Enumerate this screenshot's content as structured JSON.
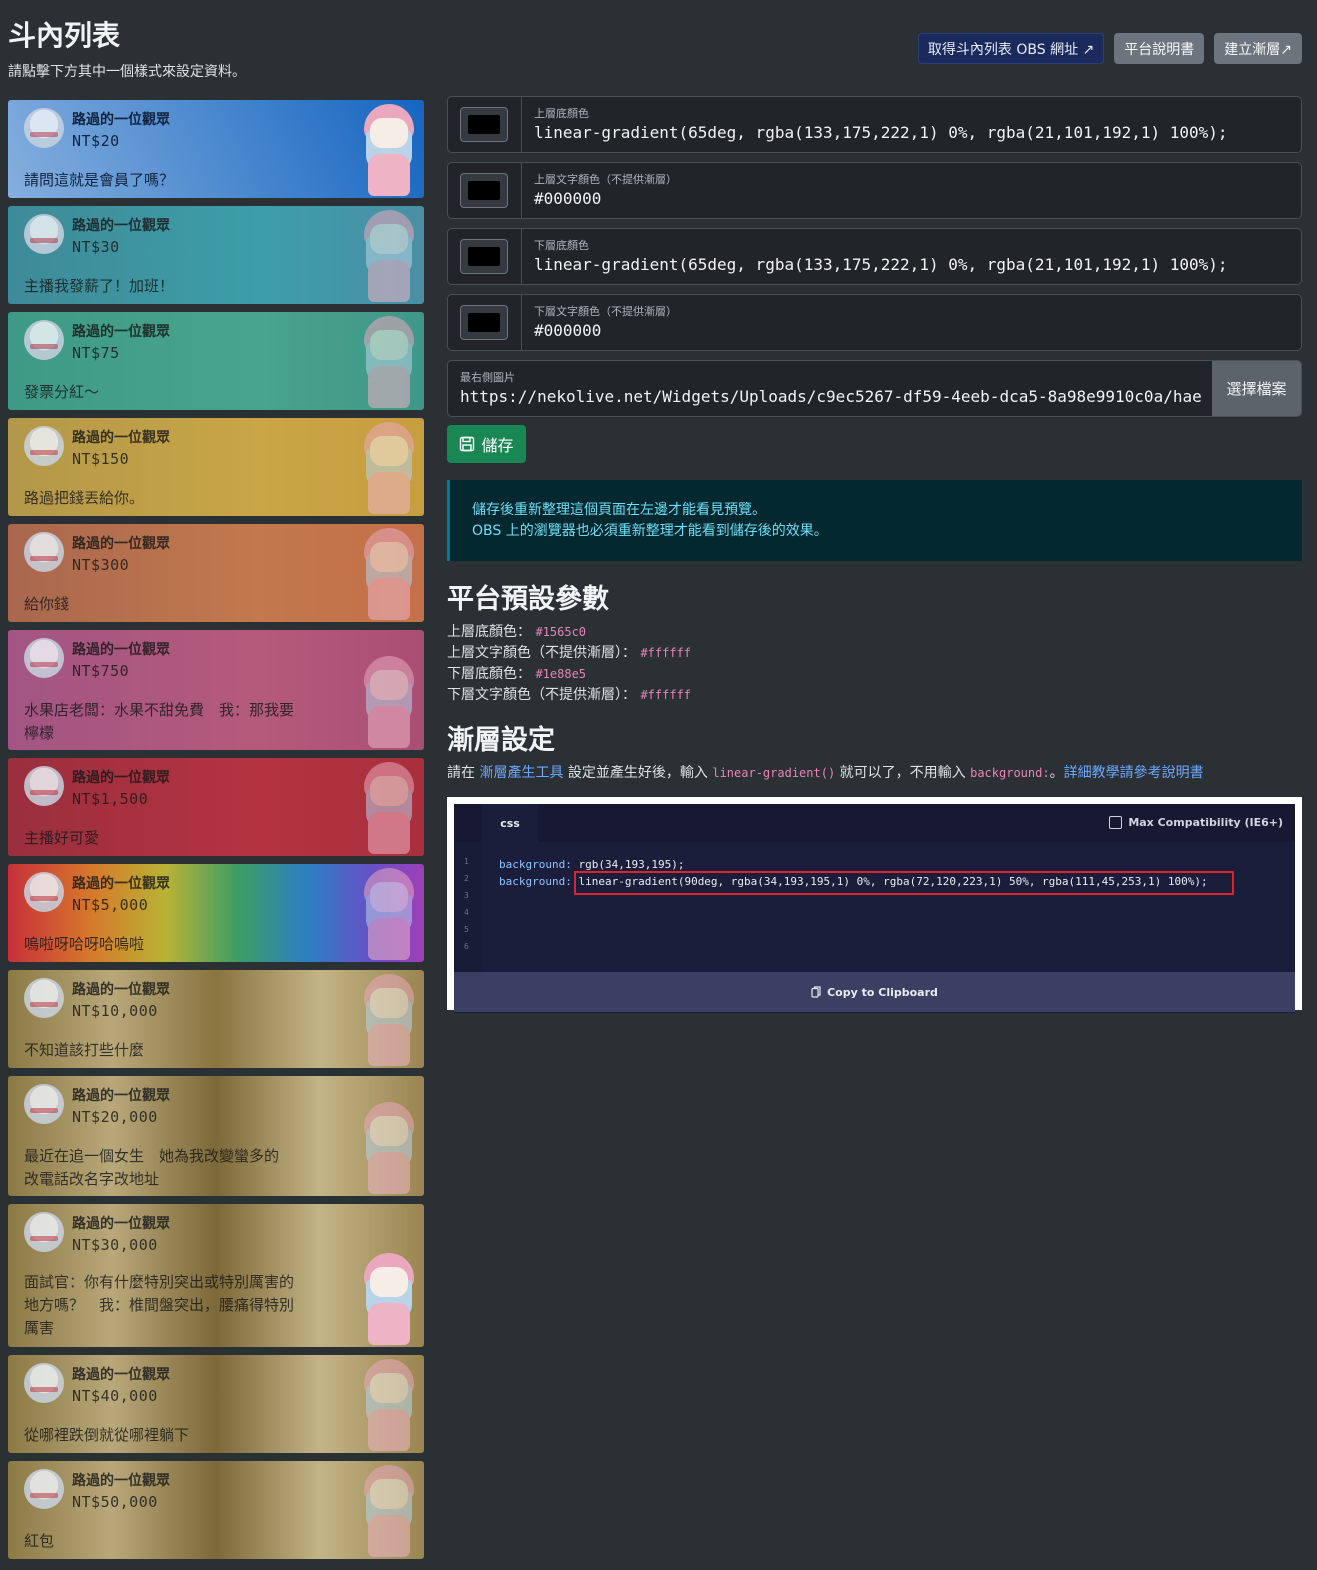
{
  "header": {
    "title": "斗內列表",
    "subtitle": "請點擊下方其中一個樣式來設定資料。",
    "buttons": {
      "obs_url": "取得斗內列表 OBS 網址 ↗",
      "manual": "平台說明書",
      "create_gradient": "建立漸層↗"
    }
  },
  "donations": [
    {
      "name": "路過的一位觀眾",
      "amount": "NT$20",
      "message": "請問這就是會員了嗎？"
    },
    {
      "name": "路過的一位觀眾",
      "amount": "NT$30",
      "message": "主播我發薪了！加班！"
    },
    {
      "name": "路過的一位觀眾",
      "amount": "NT$75",
      "message": "發票分紅～"
    },
    {
      "name": "路過的一位觀眾",
      "amount": "NT$150",
      "message": "路過把錢丟給你。"
    },
    {
      "name": "路過的一位觀眾",
      "amount": "NT$300",
      "message": "給你錢"
    },
    {
      "name": "路過的一位觀眾",
      "amount": "NT$750",
      "message": "水果店老闆：水果不甜免費　我：那我要檸檬"
    },
    {
      "name": "路過的一位觀眾",
      "amount": "NT$1,500",
      "message": "主播好可愛"
    },
    {
      "name": "路過的一位觀眾",
      "amount": "NT$5,000",
      "message": "嗚啦呀哈呀哈嗚啦"
    },
    {
      "name": "路過的一位觀眾",
      "amount": "NT$10,000",
      "message": "不知道該打些什麼"
    },
    {
      "name": "路過的一位觀眾",
      "amount": "NT$20,000",
      "message": "最近在追一個女生　她為我改變蠻多的　改電話改名字改地址"
    },
    {
      "name": "路過的一位觀眾",
      "amount": "NT$30,000",
      "message": "面試官：你有什麼特別突出或特別厲害的地方嗎？　我：椎間盤突出，腰痛得特別厲害"
    },
    {
      "name": "路過的一位觀眾",
      "amount": "NT$40,000",
      "message": "從哪裡跌倒就從哪裡躺下"
    },
    {
      "name": "路過的一位觀眾",
      "amount": "NT$50,000",
      "message": "紅包"
    }
  ],
  "settings": {
    "top_bg": {
      "label": "上層底顏色",
      "value": "linear-gradient(65deg, rgba(133,175,222,1) 0%, rgba(21,101,192,1) 100%);"
    },
    "top_text": {
      "label": "上層文字顏色（不提供漸層）",
      "value": "#000000"
    },
    "bottom_bg": {
      "label": "下層底顏色",
      "value": "linear-gradient(65deg, rgba(133,175,222,1) 0%, rgba(21,101,192,1) 100%);"
    },
    "bottom_text": {
      "label": "下層文字顏色（不提供漸層）",
      "value": "#000000"
    },
    "right_image": {
      "label": "最右側圖片",
      "value": "https://nekolive.net/Widgets/Uploads/c9ec5267-df59-4eeb-dca5-8a98e9910c0a/hae",
      "button": "選擇檔案"
    },
    "save_label": "儲存"
  },
  "alert": {
    "line1": "儲存後重新整理這個頁面在左邊才能看見預覽。",
    "line2": "OBS 上的瀏覽器也必須重新整理才能看到儲存後的效果。"
  },
  "defaults": {
    "title": "平台預設參數",
    "items": [
      {
        "label": "上層底顏色：",
        "value": "#1565c0"
      },
      {
        "label": "上層文字顏色（不提供漸層）：",
        "value": "#ffffff"
      },
      {
        "label": "下層底顏色：",
        "value": "#1e88e5"
      },
      {
        "label": "下層文字顏色（不提供漸層）：",
        "value": "#ffffff"
      }
    ]
  },
  "gradient": {
    "title": "漸層設定",
    "desc_1": "請在 ",
    "tool_link": "漸層產生工具",
    "desc_2": " 設定並產生好後，輸入 ",
    "code_1": "linear-gradient()",
    "desc_3": " 就可以了，不用輸入 ",
    "code_2": "background:",
    "desc_4": "。",
    "manual_link": "詳細教學請參考說明書"
  },
  "editor": {
    "tab": "css",
    "max_compat": "Max Compatibility (IE6+)",
    "line_numbers": [
      "1",
      "2",
      "3",
      "4",
      "5",
      "6"
    ],
    "line1_prop": "background:",
    "line1_val": " rgb(34,193,195);",
    "line2_prop": "background:",
    "line2_val": " linear-gradient(90deg, rgba(34,193,195,1) 0%, rgba(72,120,223,1) 50%, rgba(111,45,253,1) 100%);",
    "copy": "Copy to Clipboard"
  }
}
